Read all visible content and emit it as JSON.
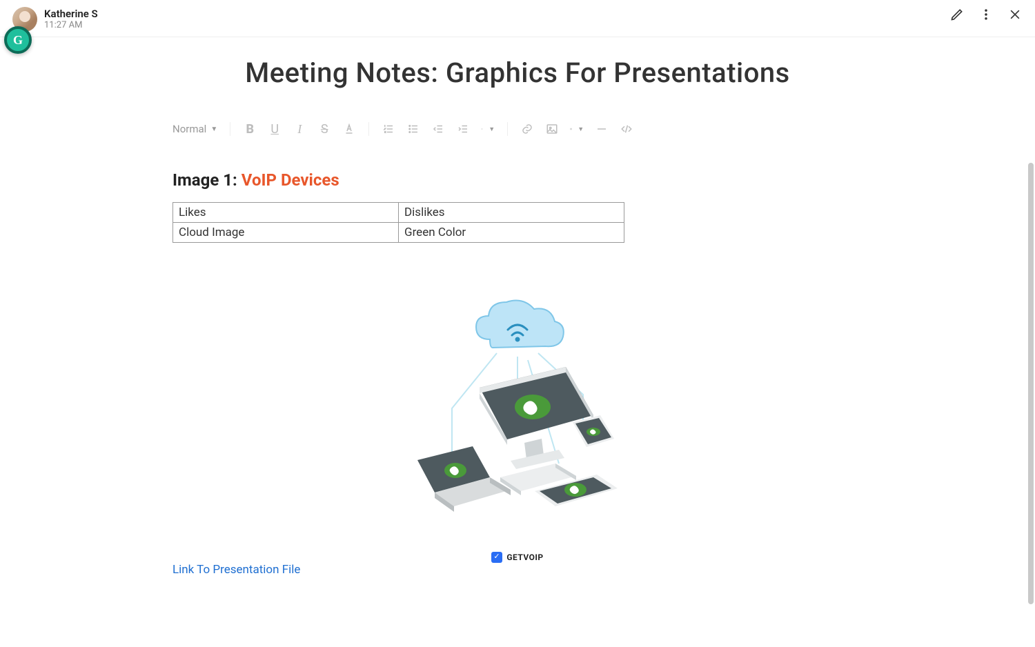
{
  "header": {
    "user_name": "Katherine S",
    "time": "11:27 AM"
  },
  "doc": {
    "title": "Meeting Notes: Graphics For Presentations",
    "toolbar": {
      "format_label": "Normal"
    },
    "section_heading_prefix": "Image 1: ",
    "section_heading_link": "VoIP Devices",
    "table": {
      "r1c1": "Likes",
      "r1c2": "Dislikes",
      "r2c1": "Cloud Image",
      "r2c2": "Green Color"
    },
    "illustration_tag": "GETVOIP",
    "presentation_link": "Link To Presentation File"
  }
}
